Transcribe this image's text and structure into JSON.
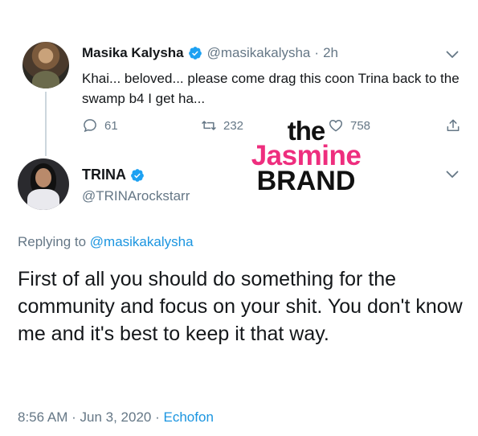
{
  "top_tweet": {
    "name": "Masika Kalysha",
    "handle": "@masikakalysha",
    "separator": "·",
    "time": "2h",
    "text": "Khai... beloved... please come drag this coon Trina back to the swamp b4 I get ha...",
    "replies": "61",
    "retweets": "232",
    "likes": "758"
  },
  "watermark": {
    "line1": "the",
    "line2": "Jasmine",
    "line3": "BRAND"
  },
  "main_tweet": {
    "name": "TRINA",
    "handle": "@TRINArockstarr",
    "replying_prefix": "Replying to ",
    "replying_to": "@masikakalysha",
    "text": "First of all you should do something for the community and focus on your shit. You don't know me and it's best to keep it that way.",
    "time": "8:56 AM",
    "separator1": "·",
    "date": "Jun 3, 2020",
    "separator2": "·",
    "source": "Echofon"
  },
  "colors": {
    "verified_blue": "#1da1f2",
    "link_blue": "#1b95e0",
    "secondary_text": "#657786",
    "watermark_pink": "#ee2e7e"
  }
}
